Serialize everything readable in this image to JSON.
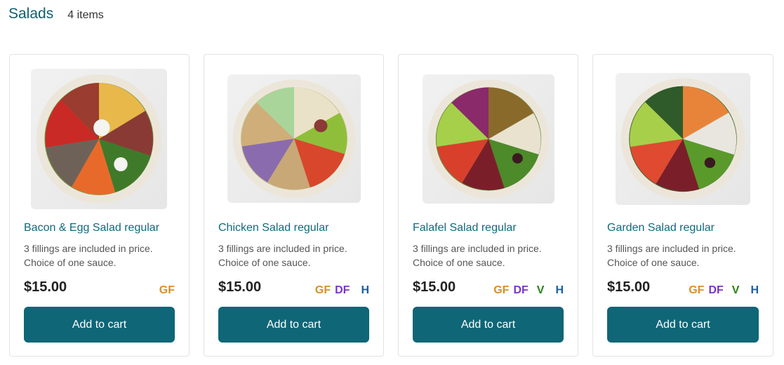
{
  "section": {
    "title": "Salads",
    "count": "4 items"
  },
  "badge_colors": {
    "GF": "#d4902a",
    "DF": "#7b35c9",
    "V": "#2a7f17",
    "H": "#1d5d9c"
  },
  "button_color": "#0f6677",
  "products": [
    {
      "title": "Bacon & Egg Salad regular",
      "desc_line1": "3 fillings are included in price.",
      "desc_line2": "Choice of one sauce.",
      "price": "$15.00",
      "badges": [
        "GF"
      ],
      "button": "Add to cart",
      "image": "bacon-egg-salad-bowl"
    },
    {
      "title": "Chicken Salad regular",
      "desc_line1": "3 fillings are included in price.",
      "desc_line2": "Choice of one sauce.",
      "price": "$15.00",
      "badges": [
        "GF",
        "DF",
        "H"
      ],
      "button": "Add to cart",
      "image": "chicken-salad-bowl"
    },
    {
      "title": "Falafel Salad regular",
      "desc_line1": "3 fillings are included in price.",
      "desc_line2": "Choice of one sauce.",
      "price": "$15.00",
      "badges": [
        "GF",
        "DF",
        "V",
        "H"
      ],
      "button": "Add to cart",
      "image": "falafel-salad-bowl"
    },
    {
      "title": "Garden Salad regular",
      "desc_line1": "3 fillings are included in price.",
      "desc_line2": "Choice of one sauce.",
      "price": "$15.00",
      "badges": [
        "GF",
        "DF",
        "V",
        "H"
      ],
      "button": "Add to cart",
      "image": "garden-salad-bowl"
    }
  ]
}
